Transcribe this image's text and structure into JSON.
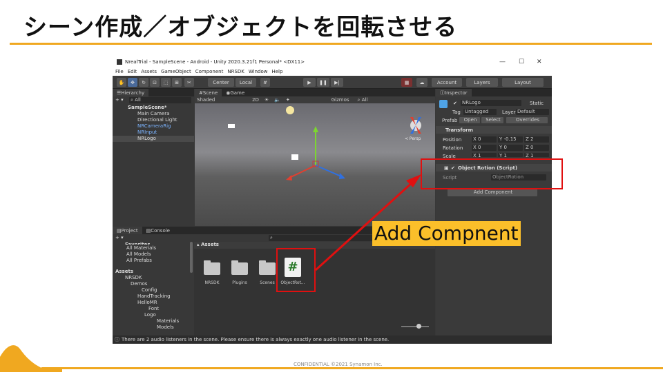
{
  "slide": {
    "title": "シーン作成／オブジェクトを回転させる",
    "footer": "CONFIDENTIAL  ©2021 Synamon Inc.",
    "callout_text": "Add Compnent"
  },
  "window": {
    "title": "NrealTrial - SampleScene - Android - Unity 2020.3.21f1 Personal* <DX11>",
    "controls": [
      "—",
      "☐",
      "✕"
    ]
  },
  "menu": [
    "File",
    "Edit",
    "Assets",
    "GameObject",
    "Component",
    "NRSDK",
    "Window",
    "Help"
  ],
  "toolbar": {
    "center": "Center",
    "local": "Local",
    "account": "Account",
    "layers": "Layers",
    "layout": "Layout"
  },
  "hierarchy": {
    "tab": "Hierarchy",
    "search": "All",
    "items": [
      "SampleScene*",
      "Main Camera",
      "Directional Light",
      "NRCameraRig",
      "NRInput",
      "NRLogo"
    ]
  },
  "scene": {
    "tabs": [
      "Scene",
      "Game"
    ],
    "shading": "Shaded",
    "mode": "2D",
    "gizmos": "Gizmos",
    "search": "All",
    "persp": "< Persp"
  },
  "inspector": {
    "tab": "Inspector",
    "object_name": "NRLogo",
    "static": "Static",
    "tag_label": "Tag",
    "tag_value": "Untagged",
    "layer_label": "Layer",
    "layer_value": "Default",
    "prefab_label": "Prefab",
    "open": "Open",
    "select": "Select",
    "overrides": "Overrides",
    "transform": "Transform",
    "position_label": "Position",
    "rotation_label": "Rotation",
    "scale_label": "Scale",
    "position": {
      "x": "X 0",
      "y": "Y -0.15",
      "z": "Z 2"
    },
    "rotation": {
      "x": "X 0",
      "y": "Y 0",
      "z": "Z 0"
    },
    "scale": {
      "x": "X 1",
      "y": "Y 1",
      "z": "Z 1"
    },
    "component": "Object Rotion (Script)",
    "script_label": "Script",
    "script_value": "ObjectRotion",
    "add_component": "Add Component"
  },
  "project": {
    "tabs": [
      "Project",
      "Console"
    ],
    "tree": [
      "Favorites",
      "All Materials",
      "All Models",
      "All Prefabs",
      "Assets",
      "NRSDK",
      "Demos",
      "Config",
      "HandTracking",
      "HelloMR",
      "Font",
      "Logo",
      "Materials",
      "Models"
    ],
    "breadcrumb": "Assets",
    "assets": [
      "NRSDK",
      "Plugins",
      "Scenes",
      "ObjectRot..."
    ]
  },
  "status": "There are 2 audio listeners in the scene. Please ensure there is always exactly one audio listener in the scene.",
  "colors": {
    "accent": "#f0a820",
    "callout": "#e01010",
    "callout_bg": "#fbbf2a"
  }
}
